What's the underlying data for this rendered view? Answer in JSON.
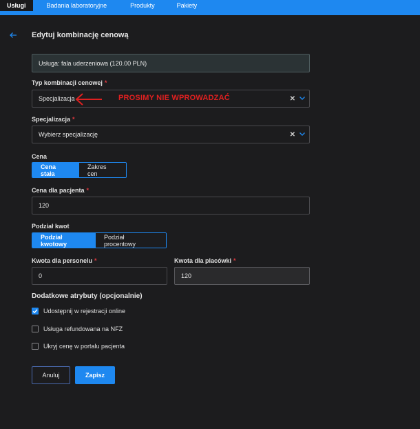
{
  "nav": {
    "tabs": [
      "Usługi",
      "Badania laboratoryjne",
      "Produkty",
      "Pakiety"
    ],
    "active_index": 0
  },
  "header": {
    "back_icon": "arrow-left-icon",
    "title": "Edytuj kombinację cenową"
  },
  "service_info": "Usługa: fala uderzeniowa (120.00 PLN)",
  "price_combination_type": {
    "label": "Typ kombinacji cenowej",
    "value": "Specjalizacja"
  },
  "annotation": {
    "text": "PROSIMY NIE WPROWADZAĆ",
    "color": "#e02020"
  },
  "specialization": {
    "label": "Specjalizacja",
    "placeholder": "Wybierz specjalizację"
  },
  "price": {
    "label": "Cena",
    "options": [
      "Cena stała",
      "Zakres cen"
    ],
    "selected": "Cena stała"
  },
  "patient_price": {
    "label": "Cena dla pacjenta",
    "value": "120"
  },
  "split": {
    "label": "Podział kwot",
    "options": [
      "Podział kwotowy",
      "Podział procentowy"
    ],
    "selected": "Podział kwotowy"
  },
  "staff_amount": {
    "label": "Kwota dla personelu",
    "value": "0"
  },
  "facility_amount": {
    "label": "Kwota dla placówki",
    "value": "120"
  },
  "extra": {
    "title": "Dodatkowe atrybuty (opcjonalnie)",
    "items": [
      {
        "label": "Udostępnij w rejestracji online",
        "checked": true
      },
      {
        "label": "Usługa refundowana na NFZ",
        "checked": false
      },
      {
        "label": "Ukryj cenę w portalu pacjenta",
        "checked": false
      }
    ]
  },
  "actions": {
    "cancel": "Anuluj",
    "save": "Zapisz"
  },
  "required_mark": "*",
  "colors": {
    "accent": "#1e88f0",
    "background": "#1c1c1e",
    "required": "#e0383f"
  }
}
